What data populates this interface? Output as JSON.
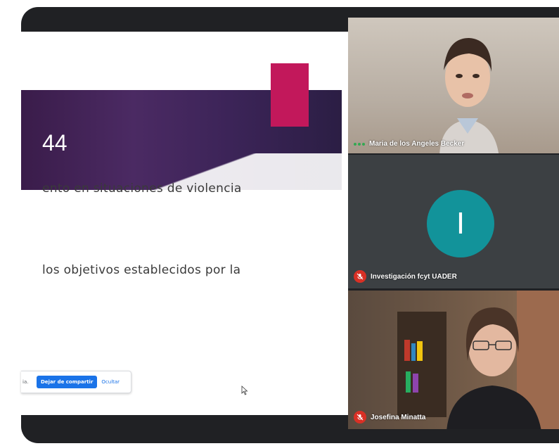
{
  "slide": {
    "title": "44",
    "line1": "ento en situaciones de violencia",
    "line2": "los objetivos establecidos por la",
    "colors": {
      "band": "#3a1c4a",
      "accent": "#c2185b"
    }
  },
  "share_bar": {
    "message": "ia.",
    "stop_label": "Dejar de compartir",
    "hide_label": "Ocultar"
  },
  "participants": [
    {
      "name": "Maria de los Angeles Becker",
      "status": "speaking-dots-icon"
    },
    {
      "name": "Investigación fcyt UADER",
      "avatar_letter": "I",
      "status": "mic-off-icon",
      "avatar_color": "#12939a"
    },
    {
      "name": "Josefina Minatta",
      "status": "mic-off-icon"
    }
  ]
}
